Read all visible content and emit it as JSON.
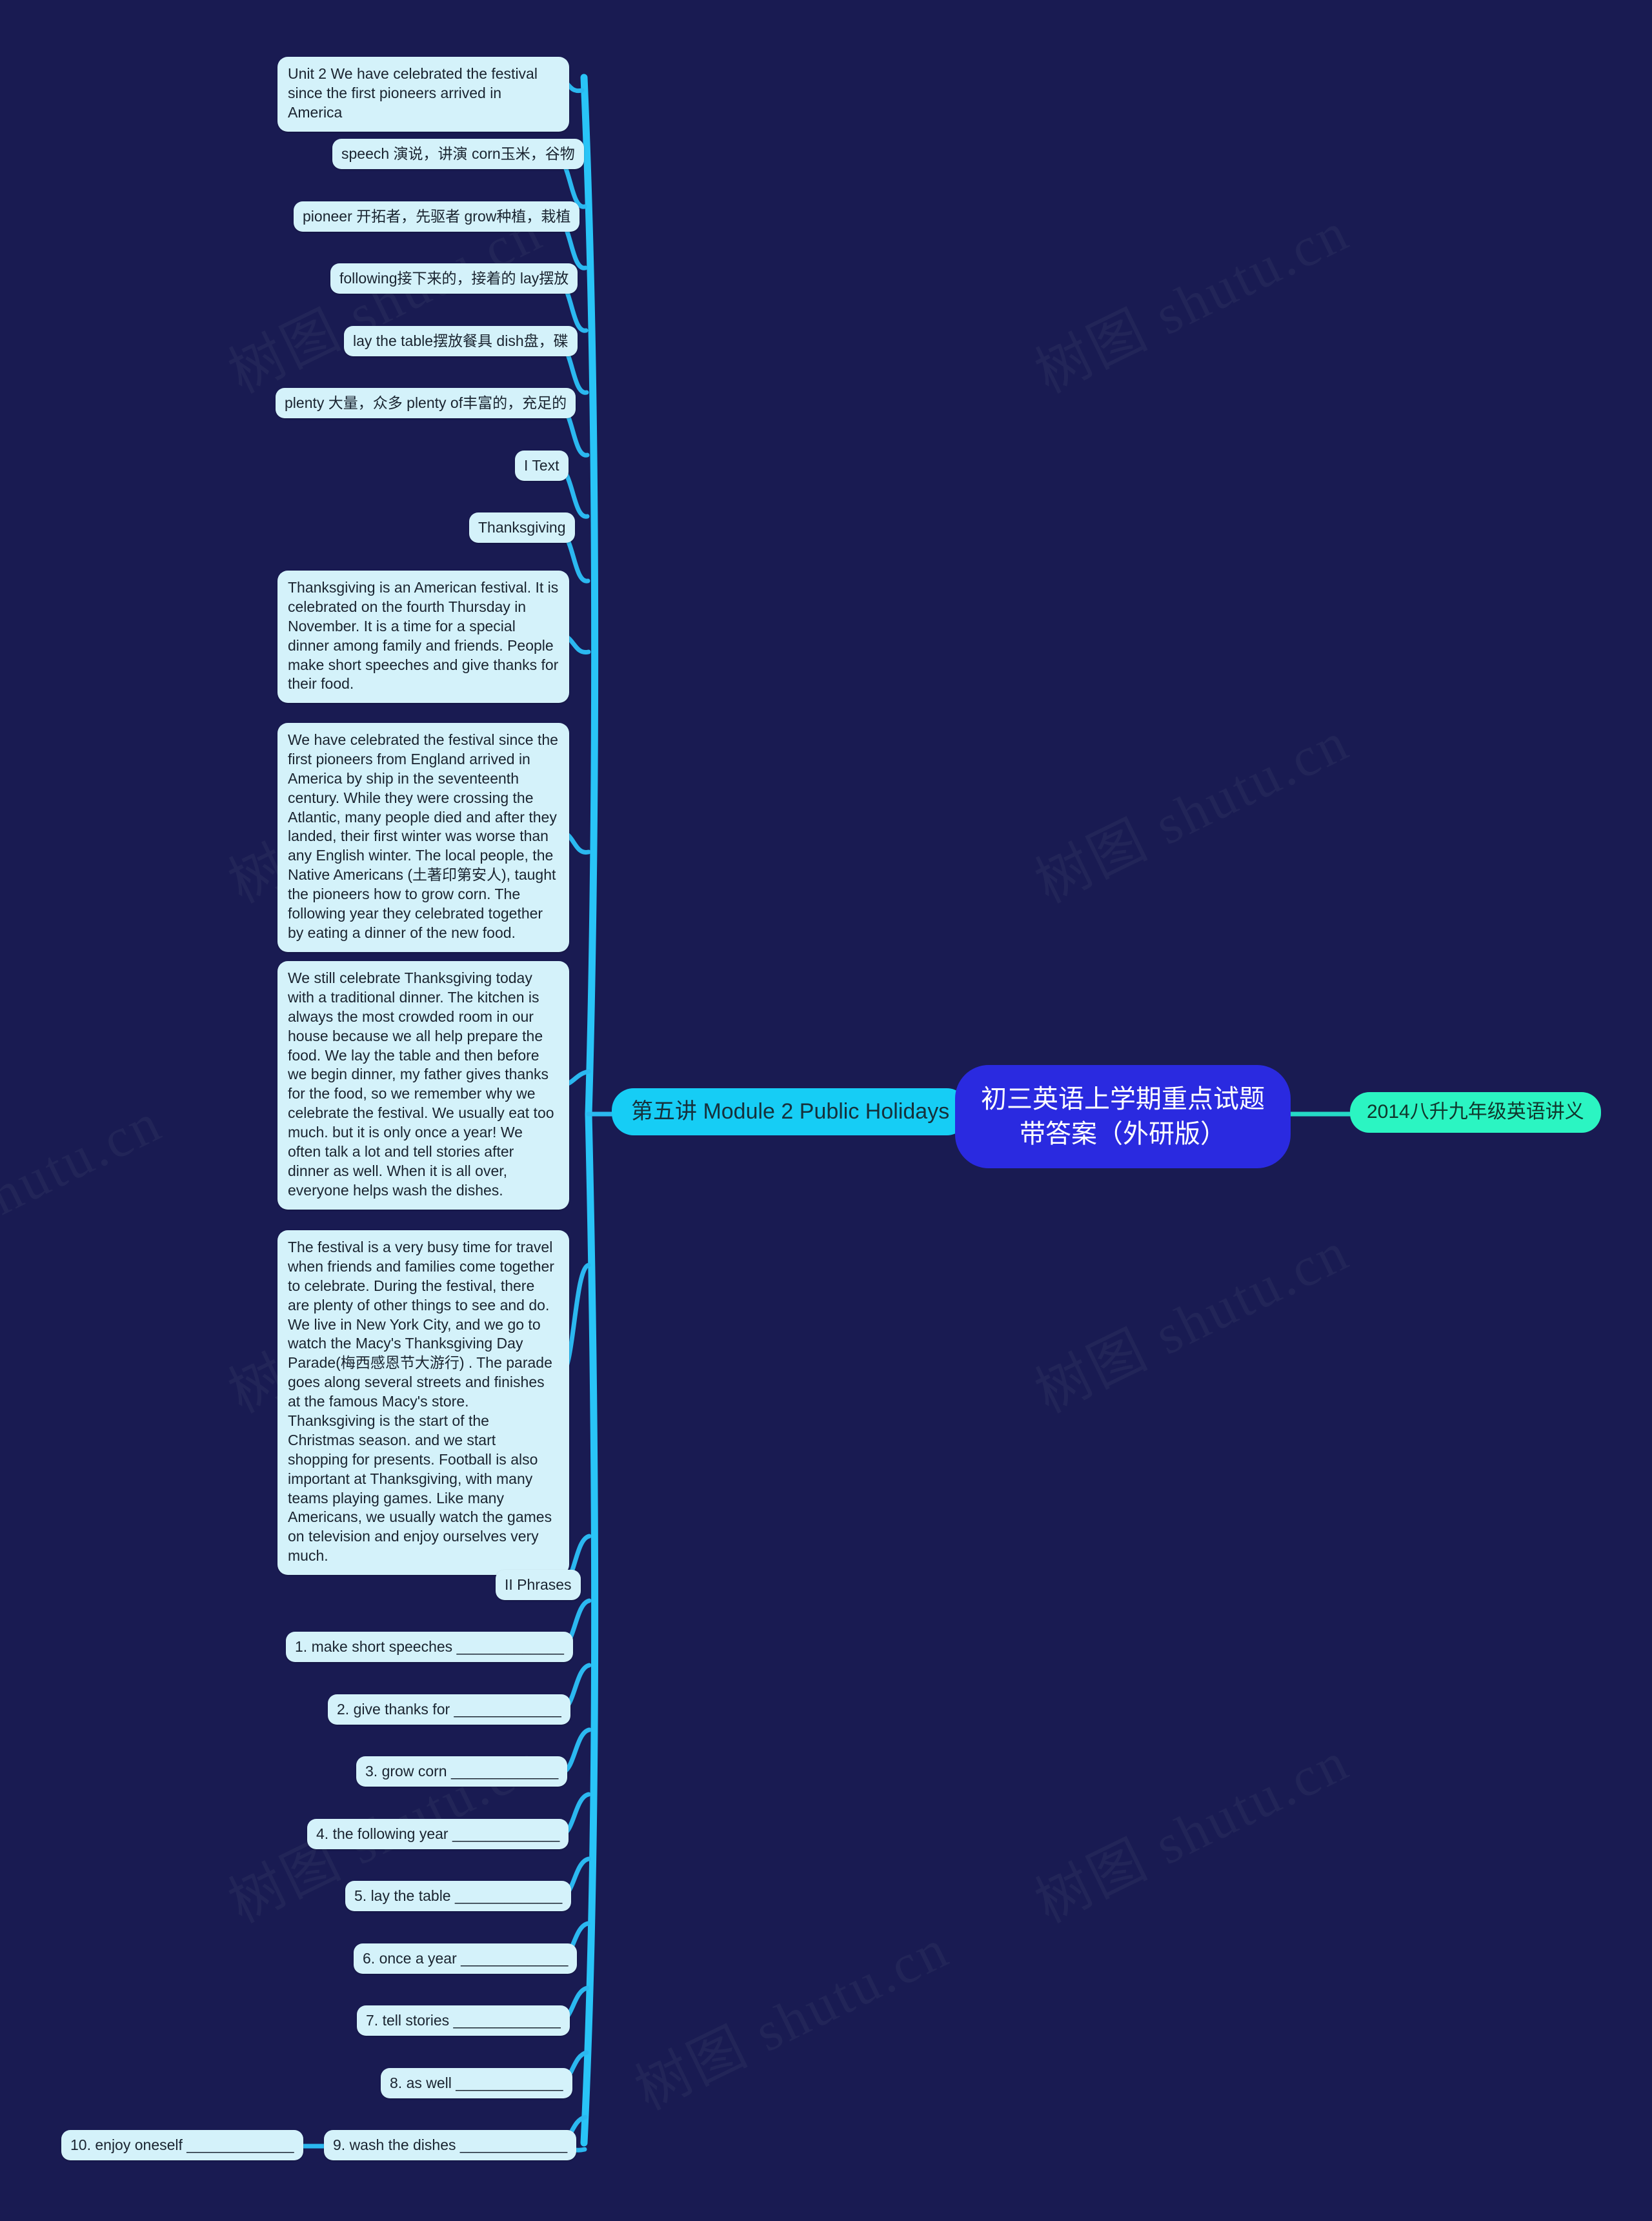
{
  "meta": {
    "background_color": "#191B52",
    "node_color": "#D4F2FA",
    "root_color": "#2A2AE0",
    "branch_color": "#16CDF5",
    "sibling_color": "#2BF5C2",
    "link_color": "#2BB8F0",
    "watermark_text": "树图 shutu.cn"
  },
  "root": {
    "label": "初三英语上学期重点试题\n带答案（外研版）"
  },
  "sibling": {
    "label": "2014八升九年级英语讲义"
  },
  "branch": {
    "label": "第五讲 Module 2 Public Holidays"
  },
  "nodes": [
    {
      "id": "unit2",
      "text": "Unit 2 We have celebrated the festival since the first pioneers arrived in America"
    },
    {
      "id": "speech",
      "text": "speech 演说，讲演 corn玉米，谷物"
    },
    {
      "id": "pioneer",
      "text": "pioneer 开拓者，先驱者 grow种植，栽植"
    },
    {
      "id": "following",
      "text": "following接下来的，接着的 lay摆放"
    },
    {
      "id": "laytable",
      "text": "lay the table摆放餐具 dish盘，碟"
    },
    {
      "id": "plenty",
      "text": "plenty 大量，众多 plenty of丰富的，充足的"
    },
    {
      "id": "itext",
      "text": "I Text"
    },
    {
      "id": "thanksgiving",
      "text": "Thanksgiving"
    },
    {
      "id": "para1",
      "text": "Thanksgiving is an American festival. It is celebrated on the fourth Thursday in November. It is a time for a special dinner among family and friends. People make short speeches and give thanks for their food."
    },
    {
      "id": "para2",
      "text": "We have celebrated the festival since the first pioneers from England arrived in America by ship in the seventeenth century. While they were crossing the Atlantic, many people died and after they landed, their first winter was worse than any English winter. The local people, the Native Americans (土著印第安人), taught the pioneers how to grow corn. The following year they celebrated together by eating a dinner of the new food."
    },
    {
      "id": "para3",
      "text": "We still celebrate Thanksgiving today with a traditional dinner. The kitchen is always the most crowded room in our house because we all help prepare the food. We lay the table and then before we begin dinner, my father gives thanks for the food, so we remember why we celebrate the festival. We usually eat too much. but it is only once a year! We often talk a lot and tell stories after dinner as well. When it is all over, everyone helps wash the dishes."
    },
    {
      "id": "para4",
      "text": "The festival is a very busy time for travel when friends and families come together to celebrate. During the festival, there are plenty of other things to see and do. We live in New York City, and we go to watch the Macy's Thanksgiving Day Parade(梅西感恩节大游行) . The parade goes along several streets and finishes at the famous Macy's store. Thanksgiving is the start of the Christmas season. and we start shopping for presents. Football is also important at Thanksgiving, with many teams playing games. Like many Americans, we usually watch the games on television and enjoy ourselves very much."
    },
    {
      "id": "phrases",
      "text": "II Phrases"
    },
    {
      "id": "p1",
      "text": "1. make short speeches _____________"
    },
    {
      "id": "p2",
      "text": "2. give thanks for _____________"
    },
    {
      "id": "p3",
      "text": "3. grow corn _____________"
    },
    {
      "id": "p4",
      "text": "4. the following year _____________"
    },
    {
      "id": "p5",
      "text": "5. lay the table _____________"
    },
    {
      "id": "p6",
      "text": "6. once a year _____________"
    },
    {
      "id": "p7",
      "text": "7. tell stories _____________"
    },
    {
      "id": "p8",
      "text": "8. as well _____________"
    },
    {
      "id": "p9",
      "text": "9. wash the dishes _____________"
    },
    {
      "id": "p10",
      "text": "10. enjoy oneself _____________"
    }
  ]
}
